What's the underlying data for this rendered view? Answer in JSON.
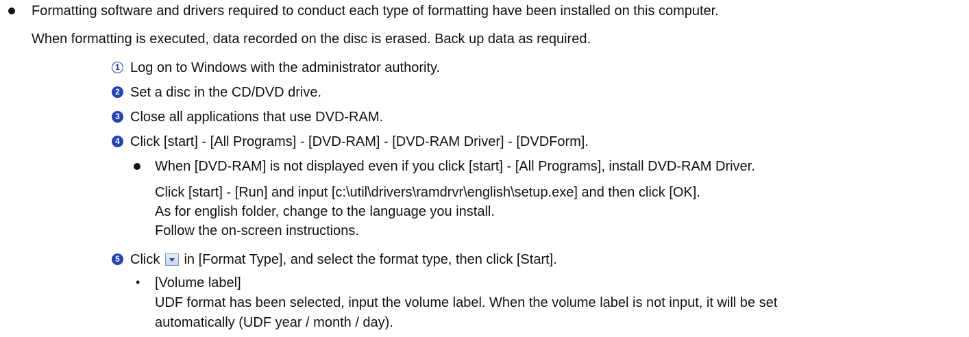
{
  "intro": {
    "line1": "Formatting software and drivers required to conduct each type of formatting have been installed on this computer.",
    "line2": "When formatting is executed, data recorded on the disc is erased. Back up data as required."
  },
  "steps": [
    {
      "num": "1",
      "text": "Log on to Windows with the administrator authority."
    },
    {
      "num": "2",
      "text": "Set a disc in the CD/DVD drive."
    },
    {
      "num": "3",
      "text": "Close all applications that use DVD-RAM."
    },
    {
      "num": "4",
      "text": "Click [start] - [All Programs] - [DVD-RAM] - [DVD-RAM Driver] - [DVDForm]."
    }
  ],
  "note": {
    "line1": "When [DVD-RAM] is not displayed even if you click [start] - [All Programs], install DVD-RAM Driver.",
    "line2": "Click [start] - [Run] and input [c:\\util\\drivers\\ramdrvr\\english\\setup.exe] and then click [OK].",
    "line3": "As for english folder, change to the language you install.",
    "line4": "Follow the on-screen instructions."
  },
  "step5": {
    "num": "5",
    "pre": "Click",
    "icon": "dropdown-arrow-icon",
    "post": "in [Format Type], and select the format type, then click [Start]."
  },
  "volume": {
    "bullet": "•",
    "title": "[Volume label]",
    "line1": "UDF format has been selected, input the volume label. When the volume label is not input, it will be set",
    "line2": "automatically (UDF year / month / day)."
  }
}
